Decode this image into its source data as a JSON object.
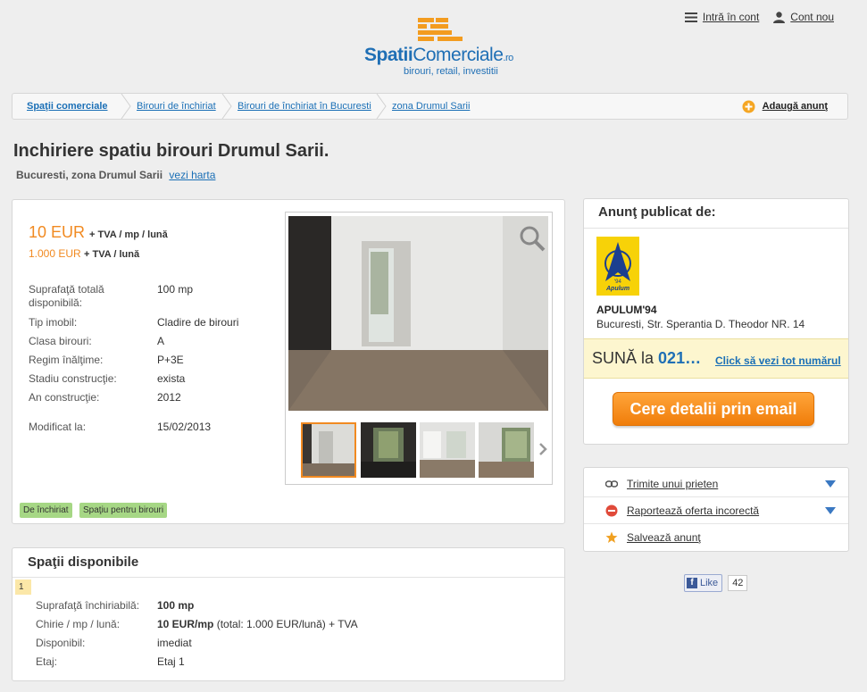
{
  "header": {
    "logo_word1": "Spatii",
    "logo_word2": "Comerciale",
    "logo_tld": ".ro",
    "tagline": "birouri, retail, investitii",
    "login_label": "Intră în cont",
    "account_label": "Cont nou"
  },
  "breadcrumb": {
    "items": [
      "Spaţii comerciale",
      "Birouri de închiriat",
      "Birouri de închiriat în Bucuresti",
      "zona Drumul Sarii"
    ],
    "add_ad_label": "Adaugă anunţ"
  },
  "listing": {
    "title": "Inchiriere spatiu birouri Drumul Sarii.",
    "location": "Bucuresti, zona Drumul Sarii",
    "map_link": "vezi harta",
    "price_main": "10 EUR",
    "price_main_suffix": "+ TVA / mp / lună",
    "price_total": "1.000 EUR",
    "price_total_suffix": "+ TVA / lună",
    "specs": [
      {
        "label": "Suprafaţă totală disponibilă:",
        "value": "100 mp"
      },
      {
        "label": "Tip imobil:",
        "value": "Cladire de birouri"
      },
      {
        "label": "Clasa birouri:",
        "value": "A"
      },
      {
        "label": "Regim înălţime:",
        "value": "P+3E"
      },
      {
        "label": "Stadiu construcţie:",
        "value": "exista"
      },
      {
        "label": "An construcţie:",
        "value": "2012"
      }
    ],
    "modified_label": "Modificat la:",
    "modified_value": "15/02/2013",
    "tags": [
      "De închiriat",
      "Spaţiu pentru birouri"
    ]
  },
  "available": {
    "title": "Spaţii disponibile",
    "index": "1",
    "rows": [
      {
        "label": "Suprafaţă închiriabilă:",
        "value": "100 mp"
      },
      {
        "label": "Chirie / mp / lună:",
        "value_bold": "10 EUR/mp",
        "value_rest": " (total: 1.000 EUR/lună) + TVA"
      },
      {
        "label": "Disponibil:",
        "value": "imediat"
      },
      {
        "label": "Etaj:",
        "value": "Etaj 1"
      }
    ]
  },
  "publisher": {
    "title": "Anunţ publicat de:",
    "logo_text": "Apulum",
    "logo_year": "'94",
    "name": "APULUM'94",
    "address": "Bucuresti, Str. Sperantia D. Theodor NR. 14",
    "call_prefix": "SUNĂ la",
    "call_number": "021…",
    "call_link": "Click să vezi tot numărul",
    "email_button": "Cere detalii prin email"
  },
  "actions": [
    {
      "label": "Trimite unui prieten",
      "icon": "link-icon"
    },
    {
      "label": "Raportează oferta incorectă",
      "icon": "report-icon"
    },
    {
      "label": "Salvează anunţ",
      "icon": "star-icon"
    }
  ],
  "facebook": {
    "like_label": "Like",
    "count": "42"
  },
  "colors": {
    "accent": "#f18a21",
    "link": "#1a6fb6",
    "tag": "#a6d785"
  }
}
